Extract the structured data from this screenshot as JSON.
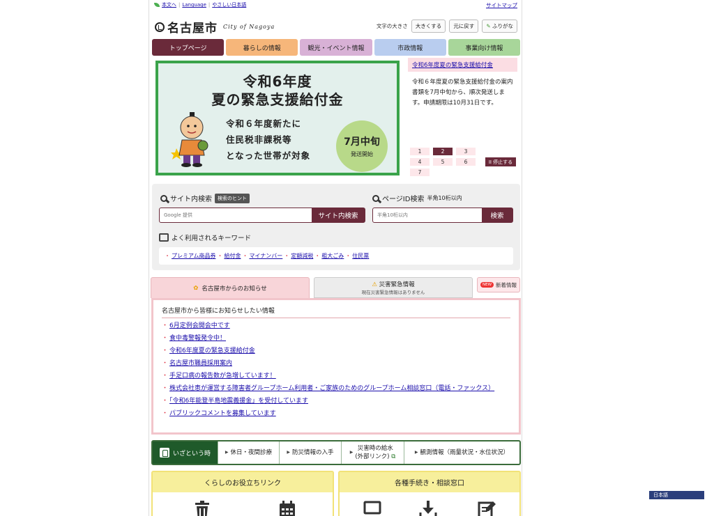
{
  "util": {
    "links": [
      "本文へ",
      "Language",
      "やさしい日本語"
    ],
    "sitemap": "サイトマップ"
  },
  "header": {
    "title": "名古屋市",
    "subtitle": "City of Nagoya",
    "fontsize_label": "文字の大きさ",
    "bigger": "大きくする",
    "reset": "元に戻す",
    "furigana": "ふりがな"
  },
  "nav": [
    {
      "label": "トップページ",
      "color": "#6a2a3a",
      "text": "#ffffff"
    },
    {
      "label": "暮らしの情報",
      "color": "#f6b67a",
      "text": "#222222"
    },
    {
      "label": "観光・イベント情報",
      "color": "#d8b1d6",
      "text": "#222222"
    },
    {
      "label": "市政情報",
      "color": "#b9cdef",
      "text": "#222222"
    },
    {
      "label": "事業向け情報",
      "color": "#a8d69a",
      "text": "#222222"
    }
  ],
  "hero": {
    "title1": "令和6年度",
    "title2": "夏の緊急支援給付金",
    "lines": [
      "令和６年度新たに",
      "住民税非課税等",
      "となった世帯が対象"
    ],
    "badge_main": "7月中旬",
    "badge_sub": "発送開始"
  },
  "side": {
    "head": "令和6年度夏の緊急支援給付金",
    "body": "令和６年度夏の緊急支援給付金の案内書類を7月中旬から、順次発送します。申請期限は10月31日です。",
    "pages": [
      "1",
      "2",
      "3",
      "4",
      "5",
      "6",
      "7"
    ],
    "active_page": "2",
    "stop": "II 停止する"
  },
  "search": {
    "site_label": "サイト内検索",
    "hint": "検索のヒント",
    "site_placeholder": "Google 提供",
    "site_button": "サイト内検索",
    "id_label": "ページID検索",
    "id_note": "半角10桁以内",
    "id_placeholder": "半角10桁以内",
    "id_button": "検索",
    "kw_label": "よく利用されるキーワード",
    "keywords": [
      "プレミアム商品券",
      "給付金",
      "マイナンバー",
      "定額減税",
      "粗大ごみ",
      "住民票"
    ]
  },
  "notices": {
    "tab_a": "名古屋市からのお知らせ",
    "tab_b": "災害緊急情報",
    "tab_b_sub": "現在災害緊急情報はありません",
    "new_badge": "NEW",
    "new_label": "新着情報",
    "heading": "名古屋市から皆様にお知らせしたい情報",
    "items": [
      "6月定例会開会中です",
      "食中毒警報発令中！",
      "令和6年度夏の緊急支援給付金",
      "名古屋市職員採用案内",
      "手足口病の報告数が急増しています！",
      "株式会社恵が運営する障害者グループホーム利用者・ご家族のためのグループホーム相談窓口（電話・ファックス）",
      "「令和6年能登半島地震義援金」を受付しています",
      "パブリックコメントを募集しています"
    ]
  },
  "emergency": {
    "lead": "いざという時",
    "items": [
      "休日・夜間診療",
      "防災情報の入手",
      "災害時の給水",
      "観測情報（雨量状況・水位状況）"
    ],
    "water_sub": "(外部リンク)"
  },
  "panels": {
    "left": "くらしのお役立ちリンク",
    "right": "各種手続き・相談窓口"
  },
  "language_button": "日本語"
}
